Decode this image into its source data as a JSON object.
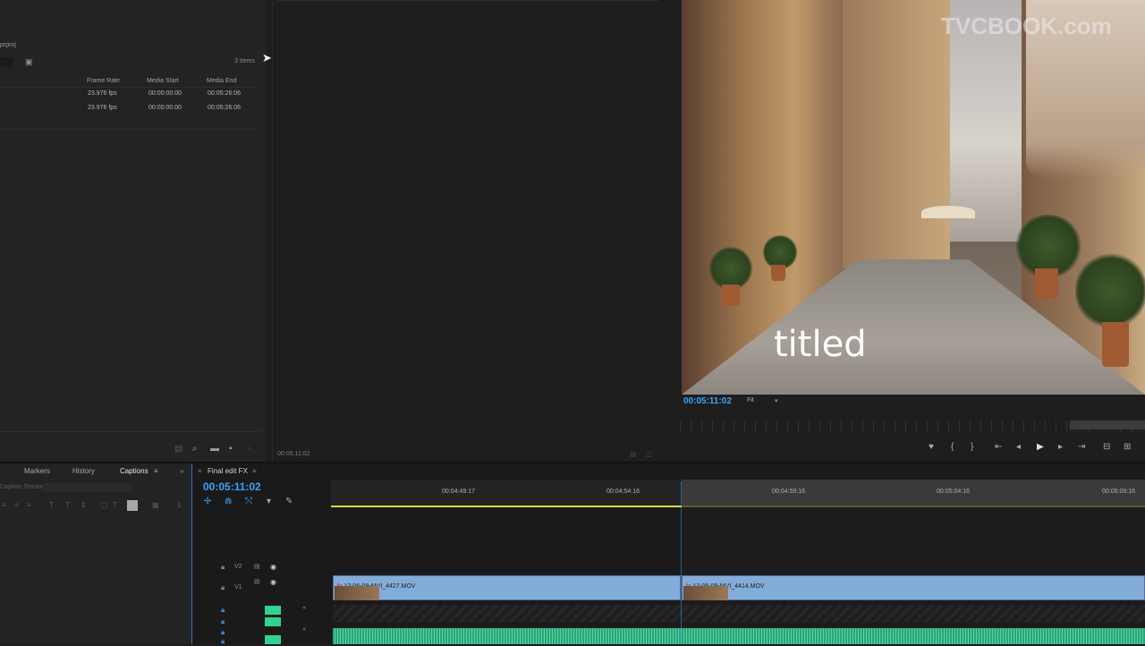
{
  "project": {
    "file_name": "prproj",
    "items_count": "3 Items",
    "columns": [
      "Frame Rate",
      "Media Start",
      "Media End"
    ],
    "rows": [
      {
        "frame_rate": "23.976 fps",
        "media_start": "00:00:00:00",
        "media_end": "00:05:26:06"
      },
      {
        "frame_rate": "23.976 fps",
        "media_start": "00:00:00:00",
        "media_end": "00:05:26:06"
      }
    ]
  },
  "source": {
    "timecode": "00:05:11:02"
  },
  "program": {
    "watermark": "TVCBOOK.com",
    "title_overlay": "titled",
    "timecode": "00:05:11:02",
    "fit": "Fit"
  },
  "lower_panel": {
    "tabs": [
      "Markers",
      "History",
      "Captions"
    ],
    "caption_stream_label": "Caption Stream:"
  },
  "timeline": {
    "sequence_name": "Final edit FX",
    "timecode": "00:05:11:02",
    "ruler_labels": [
      "00:04:49:17",
      "00:04:54:16",
      "00:04:59:16",
      "00:05:04:16",
      "00:05:09:16"
    ],
    "tracks": {
      "v2": "V2",
      "v1": "V1"
    },
    "clips": [
      {
        "name": "12-06-09-MVI_4427.MOV",
        "fx": "fx"
      },
      {
        "name": "12-06-09-MVI_4414.MOV",
        "fx": "fx"
      }
    ]
  },
  "colors": {
    "accent_blue": "#3ea3ff",
    "clip_blue": "#84acd8",
    "audio_green": "#2fd48e",
    "work_area_yellow": "#d8d84c"
  }
}
